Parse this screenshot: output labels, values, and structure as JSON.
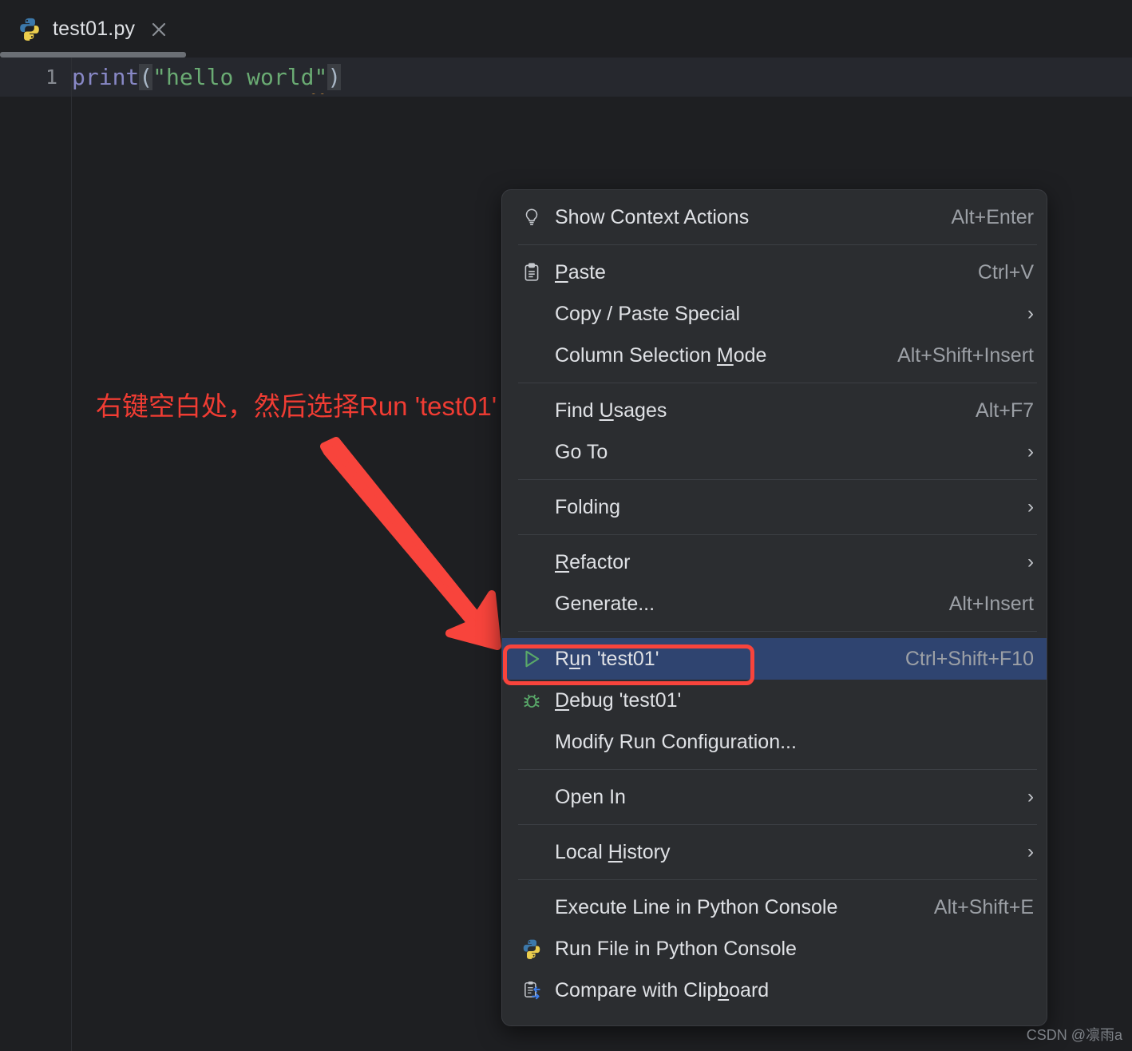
{
  "window": {
    "background_color": "#1e1f22",
    "watermark": "CSDN @凛雨a"
  },
  "tab": {
    "icon": "python-file-icon",
    "title": "test01.py",
    "close_icon": "close-icon",
    "active": true
  },
  "editor": {
    "line_number": "1",
    "code": {
      "fn": "print",
      "open_paren": "(",
      "string": "\"hello world\"",
      "close_paren": ")"
    },
    "full_line": "print(\"hello world\")"
  },
  "annotation": {
    "text": "右键空白处，然后选择Run 'test01'",
    "color": "#f03c33",
    "arrow": "red-arrow-pointing-to-run-item",
    "highlight_box_target": "Run 'test01'"
  },
  "context_menu": {
    "accent_selected_color": "#2f4470",
    "background_color": "#2b2d30",
    "groups": [
      {
        "items": [
          {
            "icon": "lightbulb-icon",
            "label": "Show Context Actions",
            "mnemonic": "",
            "shortcut": "Alt+Enter",
            "submenu": false,
            "selected": false
          }
        ]
      },
      {
        "items": [
          {
            "icon": "clipboard-paste-icon",
            "label": "Paste",
            "mnemonic": "P",
            "shortcut": "Ctrl+V",
            "submenu": false,
            "selected": false
          },
          {
            "icon": "",
            "label": "Copy / Paste Special",
            "mnemonic": "",
            "shortcut": "",
            "submenu": true,
            "selected": false
          },
          {
            "icon": "",
            "label": "Column Selection Mode",
            "mnemonic": "M",
            "shortcut": "Alt+Shift+Insert",
            "submenu": false,
            "selected": false
          }
        ]
      },
      {
        "items": [
          {
            "icon": "",
            "label": "Find Usages",
            "mnemonic": "U",
            "shortcut": "Alt+F7",
            "submenu": false,
            "selected": false
          },
          {
            "icon": "",
            "label": "Go To",
            "mnemonic": "",
            "shortcut": "",
            "submenu": true,
            "selected": false
          }
        ]
      },
      {
        "items": [
          {
            "icon": "",
            "label": "Folding",
            "mnemonic": "",
            "shortcut": "",
            "submenu": true,
            "selected": false
          }
        ]
      },
      {
        "items": [
          {
            "icon": "",
            "label": "Refactor",
            "mnemonic": "R",
            "shortcut": "",
            "submenu": true,
            "selected": false
          },
          {
            "icon": "",
            "label": "Generate...",
            "mnemonic": "",
            "shortcut": "Alt+Insert",
            "submenu": false,
            "selected": false
          }
        ]
      },
      {
        "items": [
          {
            "icon": "run-play-icon",
            "label": "Run 'test01'",
            "mnemonic": "u",
            "shortcut": "Ctrl+Shift+F10",
            "submenu": false,
            "selected": true
          },
          {
            "icon": "debug-bug-icon",
            "label": "Debug 'test01'",
            "mnemonic": "D",
            "shortcut": "",
            "submenu": false,
            "selected": false
          },
          {
            "icon": "",
            "label": "Modify Run Configuration...",
            "mnemonic": "",
            "shortcut": "",
            "submenu": false,
            "selected": false
          }
        ]
      },
      {
        "items": [
          {
            "icon": "",
            "label": "Open In",
            "mnemonic": "",
            "shortcut": "",
            "submenu": true,
            "selected": false
          }
        ]
      },
      {
        "items": [
          {
            "icon": "",
            "label": "Local History",
            "mnemonic": "H",
            "shortcut": "",
            "submenu": true,
            "selected": false
          }
        ]
      },
      {
        "items": [
          {
            "icon": "",
            "label": "Execute Line in Python Console",
            "mnemonic": "",
            "shortcut": "Alt+Shift+E",
            "submenu": false,
            "selected": false
          },
          {
            "icon": "python-icon",
            "label": "Run File in Python Console",
            "mnemonic": "",
            "shortcut": "",
            "submenu": false,
            "selected": false
          },
          {
            "icon": "compare-clipboard-icon",
            "label": "Compare with Clipboard",
            "mnemonic": "b",
            "shortcut": "",
            "submenu": false,
            "selected": false
          }
        ]
      }
    ]
  }
}
